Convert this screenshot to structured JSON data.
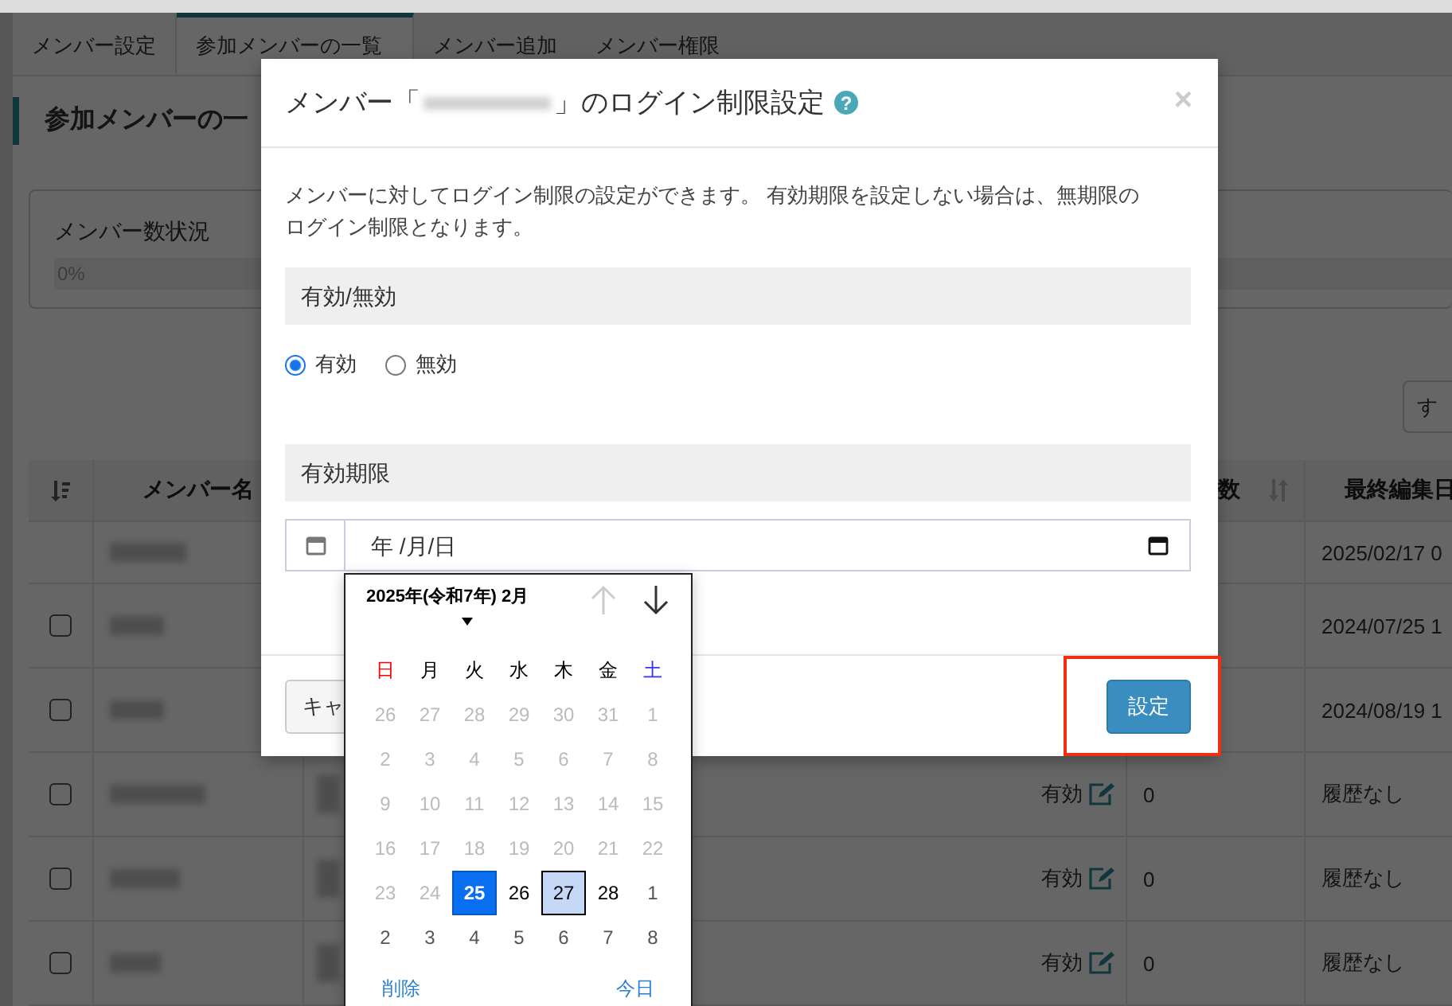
{
  "page_tabs": [
    {
      "label": "メンバー設定",
      "selected": false
    },
    {
      "label": "参加メンバーの一覧",
      "selected": true
    },
    {
      "label": "メンバー追加",
      "selected": false
    },
    {
      "label": "メンバー権限",
      "selected": false
    }
  ],
  "heading": "参加メンバーの一",
  "member_panel": {
    "title": "メンバー数状況",
    "progress": {
      "level": 0,
      "reading": "0%"
    }
  },
  "toolbar": {
    "button": "す"
  },
  "table": {
    "columns": [
      {
        "kind": "sort-icon"
      },
      {
        "kind": "text",
        "label": "メンバー名"
      },
      {
        "kind": "blank"
      },
      {
        "kind": "blank"
      },
      {
        "kind": "sortable",
        "label": "数"
      },
      {
        "kind": "text",
        "label": "最終編集日"
      }
    ],
    "rows": [
      {
        "date": "2025/02/17 0"
      },
      {
        "checked": false,
        "date": "2024/07/25 1"
      },
      {
        "checked": false,
        "date": "2024/08/19 1"
      },
      {
        "checked": false,
        "status": "有効",
        "count": "0",
        "date": "履歴なし"
      },
      {
        "checked": false,
        "status": "有効",
        "count": "0",
        "date": "履歴なし"
      },
      {
        "checked": false,
        "status": "有効",
        "count": "0",
        "date": "履歴なし"
      }
    ]
  },
  "dialog": {
    "title_prefix": "メンバー「",
    "title_suffix": "」のログイン制限設定",
    "help": "?",
    "close": "×",
    "description": "メンバーに対してログイン制限の設定ができます。 有効期限を設定しない場合は、無期限のログイン制限となります。",
    "sections": [
      {
        "kind": "radio",
        "title": "有効/無効",
        "options": [
          {
            "label": "有効",
            "selected": true
          },
          {
            "label": "無効",
            "selected": false
          }
        ]
      },
      {
        "kind": "date",
        "title": "有効期限",
        "placeholder": "年 /月/日"
      }
    ],
    "buttons": [
      {
        "kind": "cancel",
        "label": "キャ",
        "highlighted": false
      },
      {
        "kind": "primary",
        "label": "設定",
        "highlighted": true
      }
    ]
  },
  "datepicker": {
    "title": "2025年(令和7年) 2月",
    "prev_disabled": true,
    "weekdays": [
      {
        "label": "日",
        "color": "#ff0000"
      },
      {
        "label": "月",
        "color": "#000000"
      },
      {
        "label": "火",
        "color": "#000000"
      },
      {
        "label": "水",
        "color": "#000000"
      },
      {
        "label": "木",
        "color": "#000000"
      },
      {
        "label": "金",
        "color": "#000000"
      },
      {
        "label": "土",
        "color": "#3333ff"
      }
    ],
    "weeks": [
      [
        {
          "day": "26",
          "kind": "disabled",
          "selected": false,
          "focused": false
        },
        {
          "day": "27",
          "kind": "disabled",
          "selected": false,
          "focused": false
        },
        {
          "day": "28",
          "kind": "disabled",
          "selected": false,
          "focused": false
        },
        {
          "day": "29",
          "kind": "disabled",
          "selected": false,
          "focused": false
        },
        {
          "day": "30",
          "kind": "disabled",
          "selected": false,
          "focused": false
        },
        {
          "day": "31",
          "kind": "disabled",
          "selected": false,
          "focused": false
        },
        {
          "day": "1",
          "kind": "disabled",
          "selected": false,
          "focused": false
        }
      ],
      [
        {
          "day": "2",
          "kind": "disabled",
          "selected": false,
          "focused": false
        },
        {
          "day": "3",
          "kind": "disabled",
          "selected": false,
          "focused": false
        },
        {
          "day": "4",
          "kind": "disabled",
          "selected": false,
          "focused": false
        },
        {
          "day": "5",
          "kind": "disabled",
          "selected": false,
          "focused": false
        },
        {
          "day": "6",
          "kind": "disabled",
          "selected": false,
          "focused": false
        },
        {
          "day": "7",
          "kind": "disabled",
          "selected": false,
          "focused": false
        },
        {
          "day": "8",
          "kind": "disabled",
          "selected": false,
          "focused": false
        }
      ],
      [
        {
          "day": "9",
          "kind": "disabled",
          "selected": false,
          "focused": false
        },
        {
          "day": "10",
          "kind": "disabled",
          "selected": false,
          "focused": false
        },
        {
          "day": "11",
          "kind": "disabled",
          "selected": false,
          "focused": false
        },
        {
          "day": "12",
          "kind": "disabled",
          "selected": false,
          "focused": false
        },
        {
          "day": "13",
          "kind": "disabled",
          "selected": false,
          "focused": false
        },
        {
          "day": "14",
          "kind": "disabled",
          "selected": false,
          "focused": false
        },
        {
          "day": "15",
          "kind": "disabled",
          "selected": false,
          "focused": false
        }
      ],
      [
        {
          "day": "16",
          "kind": "disabled",
          "selected": false,
          "focused": false
        },
        {
          "day": "17",
          "kind": "disabled",
          "selected": false,
          "focused": false
        },
        {
          "day": "18",
          "kind": "disabled",
          "selected": false,
          "focused": false
        },
        {
          "day": "19",
          "kind": "disabled",
          "selected": false,
          "focused": false
        },
        {
          "day": "20",
          "kind": "disabled",
          "selected": false,
          "focused": false
        },
        {
          "day": "21",
          "kind": "disabled",
          "selected": false,
          "focused": false
        },
        {
          "day": "22",
          "kind": "disabled",
          "selected": false,
          "focused": false
        }
      ],
      [
        {
          "day": "23",
          "kind": "disabled",
          "selected": false,
          "focused": false
        },
        {
          "day": "24",
          "kind": "disabled",
          "selected": false,
          "focused": false
        },
        {
          "day": "25",
          "kind": "current",
          "selected": true,
          "focused": false
        },
        {
          "day": "26",
          "kind": "current",
          "selected": false,
          "focused": false
        },
        {
          "day": "27",
          "kind": "current",
          "selected": false,
          "focused": true
        },
        {
          "day": "28",
          "kind": "current",
          "selected": false,
          "focused": false
        },
        {
          "day": "1",
          "kind": "outside",
          "selected": false,
          "focused": false
        }
      ],
      [
        {
          "day": "2",
          "kind": "outside",
          "selected": false,
          "focused": false
        },
        {
          "day": "3",
          "kind": "outside",
          "selected": false,
          "focused": false
        },
        {
          "day": "4",
          "kind": "outside",
          "selected": false,
          "focused": false
        },
        {
          "day": "5",
          "kind": "outside",
          "selected": false,
          "focused": false
        },
        {
          "day": "6",
          "kind": "outside",
          "selected": false,
          "focused": false
        },
        {
          "day": "7",
          "kind": "outside",
          "selected": false,
          "focused": false
        },
        {
          "day": "8",
          "kind": "outside",
          "selected": false,
          "focused": false
        }
      ]
    ],
    "footer": [
      {
        "kind": "clear",
        "label": "削除"
      },
      {
        "kind": "today",
        "label": "今日"
      }
    ]
  }
}
